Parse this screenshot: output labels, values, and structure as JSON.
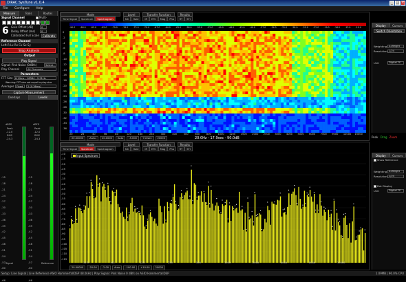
{
  "window": {
    "title": "DIRAC SysTune v1.0.4"
  },
  "menu": [
    "File",
    "Configure",
    "Help"
  ],
  "left_panel": {
    "tabs": [
      "Measure",
      "Tools",
      "Routes"
    ],
    "signal_channel": {
      "label": "Signal Channel",
      "multi_channel": "Multi-Channel",
      "channel_number": "6",
      "gain_offset": "Gain Offset (dB)",
      "delay_offset": "Delay Offset (ms)",
      "calibrated": "Calibrated Full Scale",
      "calibrate_btn": "Calibrate"
    },
    "reference_channel": {
      "label": "Reference Channel",
      "row": "Left-R  Lx  Rx  Cx  Sx  Sy"
    },
    "stop_btn": "Stop Analysis",
    "output": {
      "label": "Output",
      "play_signal": "Play Signal",
      "signal_label": "Signal: Pink Noise (0dBfs)",
      "select": "Select...",
      "play_channel": "Play Channel",
      "play_channel_value": "All Channels"
    },
    "parameters": {
      "label": "Parameters",
      "fft_size": "FFT Size",
      "fft_size_value": "8.19ms - 16384 - 2.91Hz",
      "warning": "Warning: FFT size not equal to play size",
      "averages": "Averages",
      "averages_mode": "Fixed",
      "averages_value": "2 (0.36ms)"
    },
    "capture_btn": "Capture Measurement",
    "meter_tabs": [
      "Overlays",
      "Levels"
    ],
    "meters": {
      "left": {
        "title": "dBFS",
        "peak_label": "Peak",
        "peak": "-12.0",
        "rms": "RMS",
        "rms_value": "-24.3",
        "label": "Signal",
        "level": 0.78
      },
      "right": {
        "title": "dBFS",
        "peak_label": "Peak",
        "peak": "-12.0",
        "rms": "RMS",
        "rms_value": "-24.3",
        "label": "Reference",
        "level": 0.8
      },
      "scale": [
        "0",
        "-3",
        "-6",
        "-9",
        "-12",
        "-15",
        "-18",
        "-21",
        "-24",
        "-27",
        "-30",
        "-33",
        "-36",
        "-39",
        "-42",
        "-45",
        "-48",
        "-51",
        "-54",
        "-57",
        "-60",
        "-63",
        "-66"
      ]
    }
  },
  "top_pane": {
    "groups": [
      {
        "name": "Mode",
        "btns": [
          "Time Signal",
          "Spectrum",
          "Spectrogram"
        ],
        "on": 2
      },
      {
        "name": "Level",
        "btns": [
          "NC",
          "Hold"
        ],
        "on": -1
      },
      {
        "name": "Transfer Function",
        "btns": [
          "IR",
          "ETC",
          "Mag",
          "Pha"
        ],
        "on": -1
      },
      {
        "name": "Results",
        "btns": [
          "RT",
          "STI"
        ],
        "on": -1
      }
    ],
    "colorbar_labels": [
      "-90.0",
      "-88.0",
      "-85.0",
      "-82.0",
      "-79.0",
      "-76.0",
      "-73.0",
      "-70.0",
      "-67.0",
      "-64.0",
      "-61.0",
      "-58.0",
      "-55.0",
      "-52.0",
      "-49.0",
      "-46.0",
      "-43.0",
      "-40.0",
      "-37.0",
      "-34.0",
      "-31.0",
      "-28.0",
      "-25.0",
      "-22.0",
      "-19.0",
      "-16.0",
      "-13.0",
      "-10.0"
    ],
    "y_ticks": [
      "0",
      "-2",
      "-4",
      "-6",
      "-8",
      "-10",
      "-12",
      "-14",
      "-16",
      "-18",
      "-20",
      "-22",
      "-24",
      "-26",
      "-28",
      "-30",
      "-32",
      "-34",
      "-36"
    ],
    "x_ticks": [
      "20",
      "28",
      "40",
      "56",
      "80",
      "120",
      "160",
      "240",
      "300",
      "400",
      "500",
      "600",
      "800",
      "1000",
      "1200",
      "1500",
      "2000",
      "2500",
      "3000",
      "4000",
      "5000",
      "6000",
      "7500",
      "9000",
      "12000",
      "15000"
    ],
    "readout": "20.0Hz - 17.9sec - 90.0dB",
    "controls": [
      "20.00000",
      "-Auto-",
      "20.0000",
      "Auto",
      "-5.000",
      "+10sec",
      "20000"
    ],
    "footer_right": {
      "peak": "Peak",
      "drag": "Drag",
      "zoom": "Zoom"
    },
    "right_panel": {
      "tabs": [
        "Display",
        "Cursors"
      ],
      "switch": "Switch Orientation",
      "weighting": "Weighting",
      "weighting_value": "Z-Weight",
      "resolution": "Resolution",
      "resolution_value": "1/24",
      "unit": "Unit",
      "unit_value": "Digital FS"
    }
  },
  "bottom_pane": {
    "groups": [
      {
        "name": "Mode",
        "btns": [
          "Time Signal",
          "Spectrum",
          "Spectrogram"
        ],
        "on": 1
      },
      {
        "name": "Level",
        "btns": [
          "NC",
          "Hold"
        ],
        "on": -1
      },
      {
        "name": "Transfer Function",
        "btns": [
          "IR",
          "ETC",
          "Mag",
          "Pha"
        ],
        "on": -1
      },
      {
        "name": "Results",
        "btns": [
          "RT",
          "STI"
        ],
        "on": -1
      }
    ],
    "legend": "Input Spectrum",
    "y_ticks": [
      "-10",
      "-15",
      "-20",
      "-25",
      "-30",
      "-35",
      "-40",
      "-45",
      "-50",
      "-55",
      "-60",
      "-65",
      "-70",
      "-75",
      "-80",
      "-85",
      "-90",
      "-95",
      "-100",
      "-105",
      "-110",
      "-115"
    ],
    "x_ticks": [
      "31.5",
      "63",
      "125",
      "250",
      "500",
      "1000",
      "2000",
      "4000",
      "8000",
      "10000"
    ],
    "controls": [
      "20.00000",
      "-20.00",
      "-2.00",
      "Auto",
      "-100.00",
      "+10.00",
      "20000"
    ],
    "right_panel": {
      "tabs": [
        "Display",
        "Cursors"
      ],
      "show_reference": "Show Reference",
      "weighting": "Weighting",
      "weighting_value": "Z-Weight",
      "resolution": "Resolution",
      "resolution_value": "1/24",
      "dot_display": "Dot Display",
      "unit": "Unit",
      "unit_value": "Digital FS"
    }
  },
  "status": {
    "left": "Setup: Line Signal | Live Reference ASIO HammerfallDSP 48.0kHz | Play Signal: Pink Noise 0 dBfs on ASIO HammerfallDSP",
    "right": "1.09MB | 96.0% CPU"
  },
  "colors": {
    "accent": "#b01515",
    "spectrum": "#e6e61a"
  }
}
